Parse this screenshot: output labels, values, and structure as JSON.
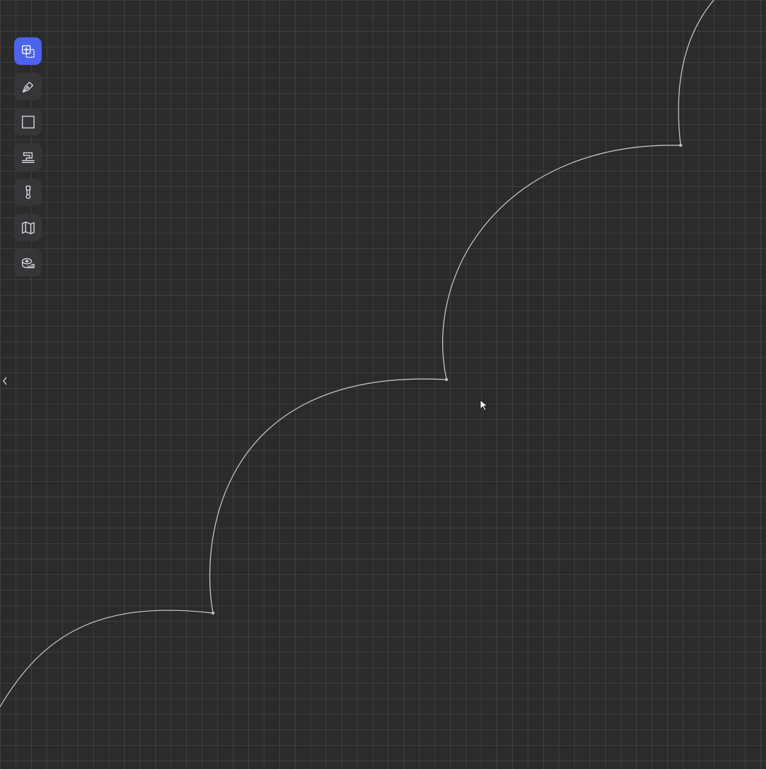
{
  "toolbar": {
    "active_tool": "select",
    "tools": [
      {
        "id": "select",
        "icon": "select-copy-icon"
      },
      {
        "id": "pen",
        "icon": "pen-nib-icon"
      },
      {
        "id": "rectangle",
        "icon": "square-icon"
      },
      {
        "id": "sewing-machine",
        "icon": "sewing-machine-icon"
      },
      {
        "id": "safety-pin",
        "icon": "safety-pin-icon"
      },
      {
        "id": "map",
        "icon": "folded-map-icon"
      },
      {
        "id": "measuring-tape",
        "icon": "measuring-tape-icon"
      }
    ]
  },
  "colors": {
    "canvas_background": "#2b2b2c",
    "grid_line": "#56564a",
    "curve_stroke": "#cfcfcf",
    "active_tool_background": "#4b63f0",
    "tool_background": "#363638"
  }
}
